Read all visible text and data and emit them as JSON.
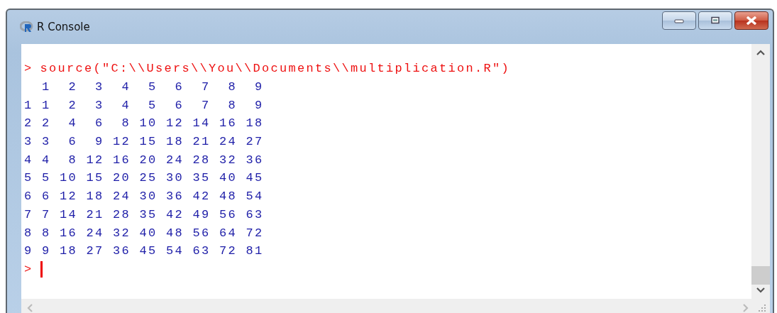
{
  "window": {
    "title": "R Console"
  },
  "console": {
    "lines": [
      {
        "kind": "command",
        "prompt": ">",
        "text": "source(\"C:\\\\Users\\\\You\\\\Documents\\\\multiplication.R\")"
      },
      {
        "kind": "output",
        "text": "  1  2  3  4  5  6  7  8  9"
      },
      {
        "kind": "output",
        "text": "1 1  2  3  4  5  6  7  8  9"
      },
      {
        "kind": "output",
        "text": "2 2  4  6  8 10 12 14 16 18"
      },
      {
        "kind": "output",
        "text": "3 3  6  9 12 15 18 21 24 27"
      },
      {
        "kind": "output",
        "text": "4 4  8 12 16 20 24 28 32 36"
      },
      {
        "kind": "output",
        "text": "5 5 10 15 20 25 30 35 40 45"
      },
      {
        "kind": "output",
        "text": "6 6 12 18 24 30 36 42 48 54"
      },
      {
        "kind": "output",
        "text": "7 7 14 21 28 35 42 49 56 63"
      },
      {
        "kind": "output",
        "text": "8 8 16 24 32 40 48 56 64 72"
      },
      {
        "kind": "output",
        "text": "9 9 18 27 36 45 54 63 72 81"
      },
      {
        "kind": "prompt",
        "prompt": ">",
        "cursor": true
      }
    ]
  }
}
